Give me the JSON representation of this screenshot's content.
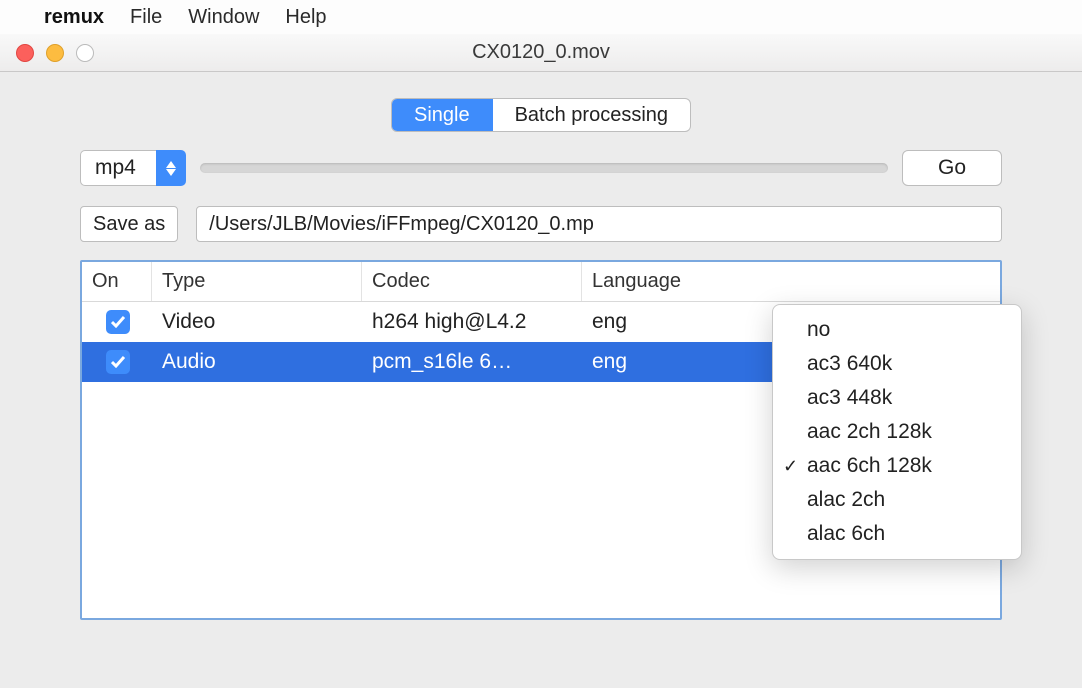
{
  "menubar": {
    "app": "remux",
    "items": [
      "File",
      "Window",
      "Help"
    ]
  },
  "window": {
    "title": "CX0120_0.mov"
  },
  "tabs": {
    "single": "Single",
    "batch": "Batch processing"
  },
  "toolbar": {
    "format": "mp4",
    "go": "Go",
    "saveas": "Save as",
    "path": "/Users/JLB/Movies/iFFmpeg/CX0120_0.mp"
  },
  "table": {
    "headers": {
      "on": "On",
      "type": "Type",
      "codec": "Codec",
      "language": "Language"
    },
    "rows": [
      {
        "on": true,
        "type": "Video",
        "codec": "h264 high@L4.2",
        "language": "eng",
        "selected": false
      },
      {
        "on": true,
        "type": "Audio",
        "codec": "pcm_s16le 6…",
        "language": "eng",
        "selected": true
      }
    ]
  },
  "popup": {
    "items": [
      {
        "label": "no",
        "checked": false
      },
      {
        "label": "ac3 640k",
        "checked": false
      },
      {
        "label": "ac3 448k",
        "checked": false
      },
      {
        "label": "aac 2ch 128k",
        "checked": false
      },
      {
        "label": "aac 6ch 128k",
        "checked": true
      },
      {
        "label": "alac 2ch",
        "checked": false
      },
      {
        "label": "alac 6ch",
        "checked": false
      }
    ]
  }
}
